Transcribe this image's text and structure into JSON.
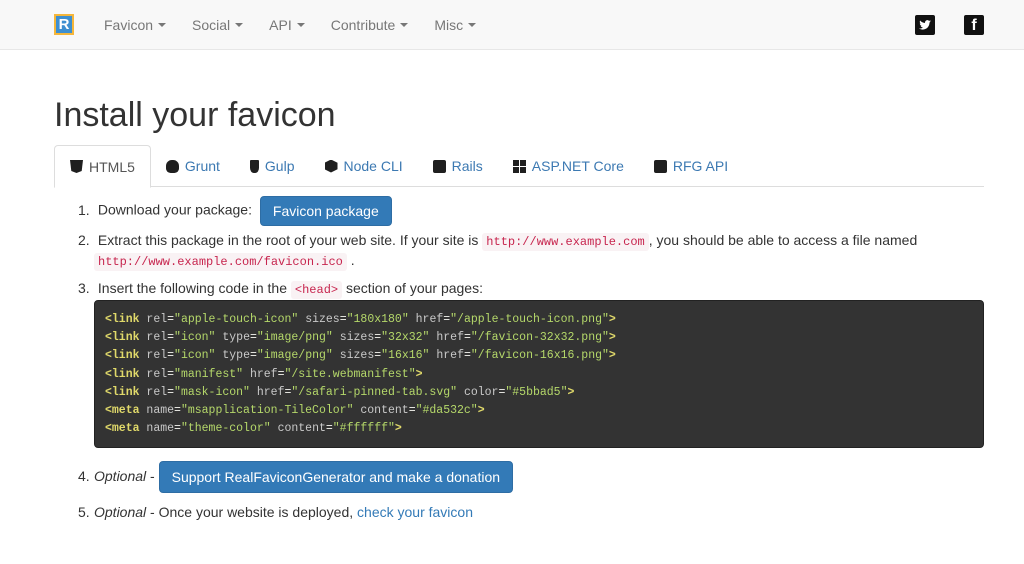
{
  "nav": {
    "logo_letter": "R",
    "menu": [
      {
        "label": "Favicon"
      },
      {
        "label": "Social"
      },
      {
        "label": "API"
      },
      {
        "label": "Contribute"
      },
      {
        "label": "Misc"
      }
    ],
    "social": {
      "twitter_glyph": "🐦",
      "facebook_glyph": "f"
    }
  },
  "page": {
    "title": "Install your favicon"
  },
  "tabs": [
    {
      "label": "HTML5",
      "icon": "html5-icon",
      "active": true
    },
    {
      "label": "Grunt",
      "icon": "grunt-icon",
      "active": false
    },
    {
      "label": "Gulp",
      "icon": "gulp-icon",
      "active": false
    },
    {
      "label": "Node CLI",
      "icon": "node-icon",
      "active": false
    },
    {
      "label": "Rails",
      "icon": "rails-icon",
      "active": false
    },
    {
      "label": "ASP.NET Core",
      "icon": "aspnet-icon",
      "active": false
    },
    {
      "label": "RFG API",
      "icon": "rfg-api-icon",
      "active": false
    }
  ],
  "steps": {
    "s1": {
      "num": "1.",
      "text": "Download your package:",
      "button": "Favicon package"
    },
    "s2": {
      "num": "2.",
      "text_a": "Extract this package in the root of your web site. If your site is",
      "code_a": "http://www.example.com",
      "text_b": ", you should be able to access a file named",
      "code_b": "http://www.example.com/favicon.ico",
      "text_c": "."
    },
    "s3": {
      "num": "3.",
      "text_a": "Insert the following code in the",
      "code": "<head>",
      "text_b": "section of your pages:"
    },
    "s4": {
      "num": "4.",
      "optional": "Optional",
      "dash": " - ",
      "button": "Support RealFaviconGenerator and make a donation"
    },
    "s5": {
      "num": "5.",
      "optional": "Optional",
      "text": " - Once your website is deployed, ",
      "link": "check your favicon"
    }
  },
  "code_lines": [
    {
      "open": "<link",
      "attrs": [
        [
          "rel",
          "\"apple-touch-icon\""
        ],
        [
          "sizes",
          "\"180x180\""
        ],
        [
          "href",
          "\"/apple-touch-icon.png\""
        ]
      ],
      "close": ">"
    },
    {
      "open": "<link",
      "attrs": [
        [
          "rel",
          "\"icon\""
        ],
        [
          "type",
          "\"image/png\""
        ],
        [
          "sizes",
          "\"32x32\""
        ],
        [
          "href",
          "\"/favicon-32x32.png\""
        ]
      ],
      "close": ">"
    },
    {
      "open": "<link",
      "attrs": [
        [
          "rel",
          "\"icon\""
        ],
        [
          "type",
          "\"image/png\""
        ],
        [
          "sizes",
          "\"16x16\""
        ],
        [
          "href",
          "\"/favicon-16x16.png\""
        ]
      ],
      "close": ">"
    },
    {
      "open": "<link",
      "attrs": [
        [
          "rel",
          "\"manifest\""
        ],
        [
          "href",
          "\"/site.webmanifest\""
        ]
      ],
      "close": ">"
    },
    {
      "open": "<link",
      "attrs": [
        [
          "rel",
          "\"mask-icon\""
        ],
        [
          "href",
          "\"/safari-pinned-tab.svg\""
        ],
        [
          "color",
          "\"#5bbad5\""
        ]
      ],
      "close": ">"
    },
    {
      "open": "<meta",
      "attrs": [
        [
          "name",
          "\"msapplication-TileColor\""
        ],
        [
          "content",
          "\"#da532c\""
        ]
      ],
      "close": ">"
    },
    {
      "open": "<meta",
      "attrs": [
        [
          "name",
          "\"theme-color\""
        ],
        [
          "content",
          "\"#ffffff\""
        ]
      ],
      "close": ">"
    }
  ],
  "colors": {
    "link": "#337ab7",
    "button": "#337ab7",
    "code_bg": "#333333",
    "inline_code": "#c7254e"
  }
}
